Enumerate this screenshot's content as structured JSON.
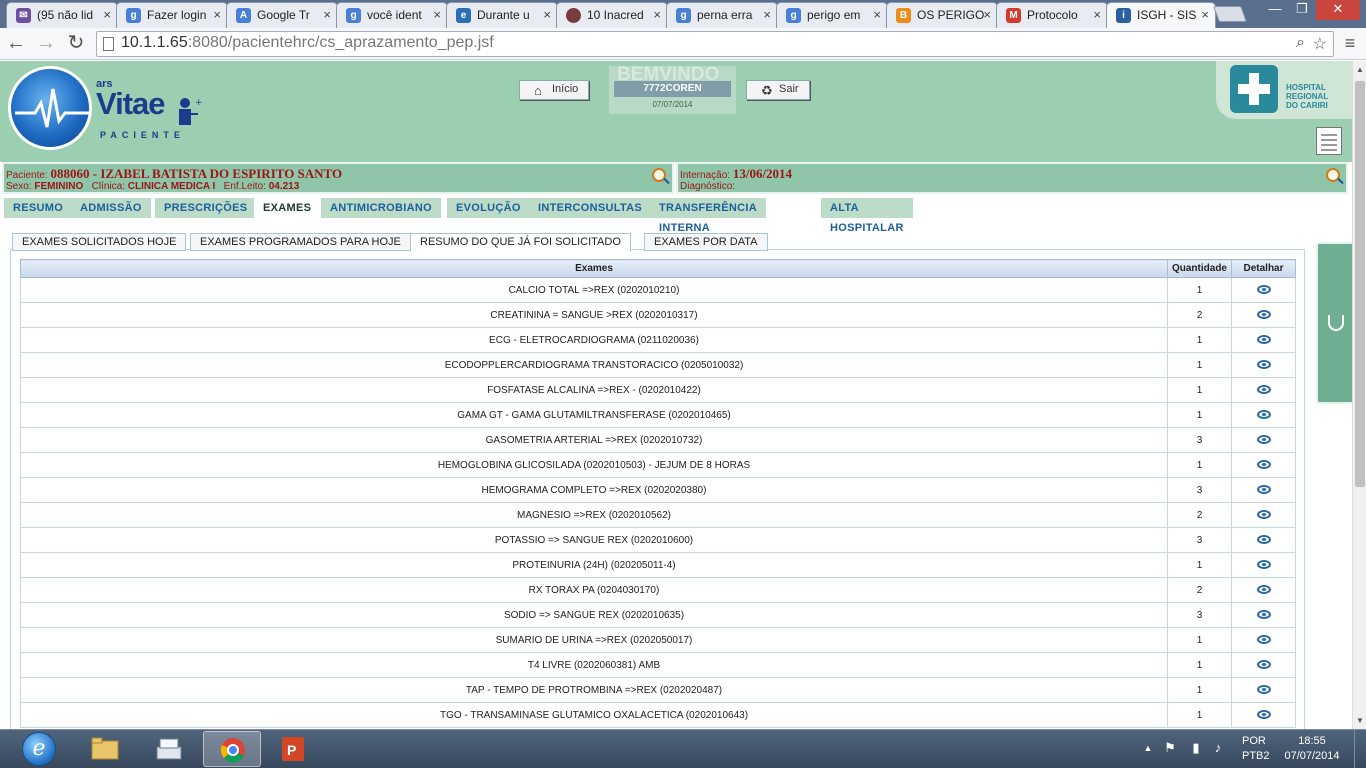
{
  "browser": {
    "tabs": [
      {
        "title": "(95 não lid",
        "icon": "mail-icon",
        "color": "#6d4ea0"
      },
      {
        "title": "Fazer login",
        "icon": "google-icon",
        "color": "#4a7fd6"
      },
      {
        "title": "Google Tr",
        "icon": "translate-icon",
        "color": "#4a7fd6"
      },
      {
        "title": "você ident",
        "icon": "google-icon",
        "color": "#4a7fd6"
      },
      {
        "title": "Durante u",
        "icon": "web-icon",
        "color": "#2d6db5"
      },
      {
        "title": "10 Inacred",
        "icon": "globe-icon",
        "color": "#7a3d3d"
      },
      {
        "title": "perna erra",
        "icon": "google-icon",
        "color": "#4a7fd6"
      },
      {
        "title": "perigo em",
        "icon": "google-icon",
        "color": "#4a7fd6"
      },
      {
        "title": "OS PERIGO",
        "icon": "blogger-icon",
        "color": "#f08c1e"
      },
      {
        "title": "Protocolo",
        "icon": "gmail-icon",
        "color": "#d23b2e"
      },
      {
        "title": "ISGH - SIS",
        "icon": "app-icon",
        "color": "#2b5fa0"
      }
    ],
    "url_host": "10.1.1.65",
    "url_rest": ":8080/pacientehrc/cs_aprazamento_pep.jsf"
  },
  "header": {
    "logo_ars": "ars",
    "logo_vitae": "Vitae",
    "logo_sub": "PACIENTE",
    "inicio_label": "Início",
    "sair_label": "Sair",
    "welcome": "BEMVINDO",
    "user": "7772COREN",
    "date": "07/07/2014",
    "hospital_lines": [
      "HOSPITAL",
      "REGIONAL",
      "DO CARIRI"
    ]
  },
  "patient": {
    "label": "Paciente:",
    "name": "088060 - IZABEL BATISTA DO ESPIRITO SANTO",
    "sex_label": "Sexo:",
    "sex": "FEMININO",
    "clinic_label": "Clínica:",
    "clinic": "CLINICA MEDICA I",
    "bed_label": "Enf.Leito:",
    "bed": "04.213",
    "admission_label": "Internação:",
    "admission": "13/06/2014",
    "diagnosis_label": "Diagnóstico:"
  },
  "menu": [
    "RESUMO",
    "ADMISSÃO",
    "PRESCRIÇÕES",
    "EXAMES",
    "ANTIMICROBIANO",
    "EVOLUÇÃO",
    "INTERCONSULTAS",
    "TRANSFERÊNCIA INTERNA",
    "ALTA HOSPITALAR"
  ],
  "active_menu": "EXAMES",
  "subtabs": [
    "EXAMES SOLICITADOS HOJE",
    "EXAMES PROGRAMADOS PARA HOJE",
    "RESUMO DO QUE JÁ FOI SOLICITADO",
    "EXAMES POR DATA"
  ],
  "active_subtab": "RESUMO DO QUE JÁ FOI SOLICITADO",
  "table": {
    "headers": [
      "Exames",
      "Quantidade",
      "Detalhar"
    ],
    "rows": [
      {
        "exam": "CALCIO TOTAL =>REX (0202010210)",
        "qty": "1"
      },
      {
        "exam": "CREATININA = SANGUE >REX (0202010317)",
        "qty": "2"
      },
      {
        "exam": "ECG - ELETROCARDIOGRAMA (0211020036)",
        "qty": "1"
      },
      {
        "exam": "ECODOPPLERCARDIOGRAMA TRANSTORACICO (0205010032)",
        "qty": "1"
      },
      {
        "exam": "FOSFATASE ALCALINA =>REX - (0202010422)",
        "qty": "1"
      },
      {
        "exam": "GAMA GT - GAMA GLUTAMILTRANSFERASE (0202010465)",
        "qty": "1"
      },
      {
        "exam": "GASOMETRIA ARTERIAL =>REX (0202010732)",
        "qty": "3"
      },
      {
        "exam": "HEMOGLOBINA GLICOSILADA (0202010503) - JEJUM DE 8 HORAS",
        "qty": "1"
      },
      {
        "exam": "HEMOGRAMA COMPLETO =>REX (0202020380)",
        "qty": "3"
      },
      {
        "exam": "MAGNESIO =>REX (0202010562)",
        "qty": "2"
      },
      {
        "exam": "POTASSIO => SANGUE REX (0202010600)",
        "qty": "3"
      },
      {
        "exam": "PROTEINURIA (24H) (020205011-4)",
        "qty": "1"
      },
      {
        "exam": "RX TORAX PA (0204030170)",
        "qty": "2"
      },
      {
        "exam": "SODIO => SANGUE REX (0202010635)",
        "qty": "3"
      },
      {
        "exam": "SUMARIO DE URINA =>REX (0202050017)",
        "qty": "1"
      },
      {
        "exam": "T4 LIVRE (0202060381) AMB",
        "qty": "1"
      },
      {
        "exam": "TAP - TEMPO DE PROTROMBINA =>REX (0202020487)",
        "qty": "1"
      },
      {
        "exam": "TGO - TRANSAMINASE GLUTAMICO OXALACETICA (0202010643)",
        "qty": "1"
      }
    ]
  },
  "taskbar": {
    "lang": "POR",
    "layout": "PTB2",
    "time": "18:55",
    "date": "07/07/2014"
  },
  "colors": {
    "header_green": "#9ccfb1",
    "patient_text": "#9c1414",
    "menu_link": "#1c5f9c"
  }
}
